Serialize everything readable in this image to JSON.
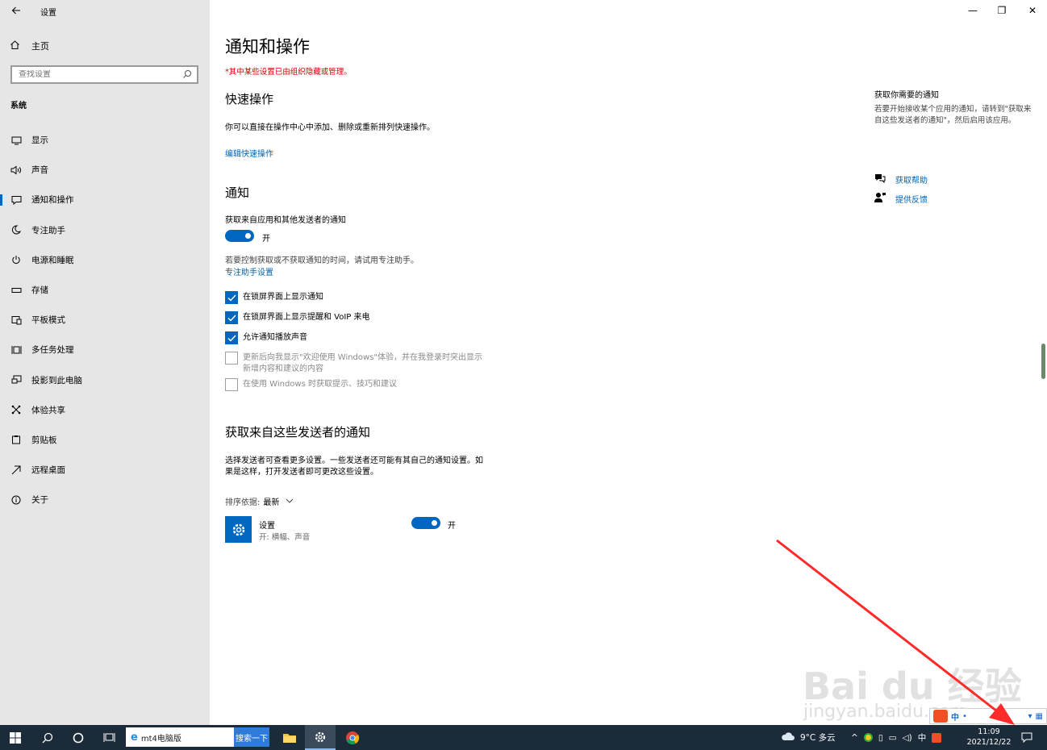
{
  "app": {
    "title": "设置"
  },
  "window": {
    "minimize": "—",
    "restore": "❐",
    "close": "✕"
  },
  "sidebar": {
    "home_label": "主页",
    "search_placeholder": "查找设置",
    "group_title": "系统",
    "items": [
      {
        "label": "显示",
        "icon": "display-icon"
      },
      {
        "label": "声音",
        "icon": "sound-icon"
      },
      {
        "label": "通知和操作",
        "icon": "notification-icon",
        "active": true
      },
      {
        "label": "专注助手",
        "icon": "moon-icon"
      },
      {
        "label": "电源和睡眠",
        "icon": "power-icon"
      },
      {
        "label": "存储",
        "icon": "storage-icon"
      },
      {
        "label": "平板模式",
        "icon": "tablet-icon"
      },
      {
        "label": "多任务处理",
        "icon": "multitask-icon"
      },
      {
        "label": "投影到此电脑",
        "icon": "project-icon"
      },
      {
        "label": "体验共享",
        "icon": "share-icon"
      },
      {
        "label": "剪贴板",
        "icon": "clipboard-icon"
      },
      {
        "label": "远程桌面",
        "icon": "remote-icon"
      },
      {
        "label": "关于",
        "icon": "info-icon"
      }
    ]
  },
  "main": {
    "title": "通知和操作",
    "managed_note": "*其中某些设置已由组织隐藏或管理。",
    "quick": {
      "title": "快速操作",
      "desc": "你可以直接在操作中心中添加、删除或重新排列快速操作。",
      "edit_link": "编辑快速操作"
    },
    "notify": {
      "title": "通知",
      "get_label": "获取来自应用和其他发送者的通知",
      "toggle_label": "开",
      "focus_hint": "若要控制获取或不获取通知的时间，请试用专注助手。",
      "focus_link": "专注助手设置",
      "checks": [
        {
          "label": "在锁屏界面上显示通知",
          "checked": true
        },
        {
          "label": "在锁屏界面上显示提醒和 VoIP 来电",
          "checked": true
        },
        {
          "label": "允许通知播放声音",
          "checked": true
        },
        {
          "label": "更新后向我显示\"欢迎使用 Windows\"体验，并在我登录时突出显示",
          "label2": "新增内容和建议的内容",
          "checked": false
        },
        {
          "label": "在使用 Windows 时获取提示、技巧和建议",
          "checked": false
        }
      ]
    },
    "senders": {
      "title": "获取来自这些发送者的通知",
      "desc1": "选择发送者可查看更多设置。一些发送者还可能有其自己的通知设置。如",
      "desc2": "果是这样，打开发送者即可更改这些设置。",
      "sort_label": "排序依据:",
      "sort_value": "最新",
      "item": {
        "name": "设置",
        "sub": "开: 横幅、声音",
        "toggle_label": "开"
      }
    }
  },
  "right": {
    "title": "获取你需要的通知",
    "text": "若要开始接收某个应用的通知，请转到\"获取来自这些发送者的通知\"，然后启用该应用。",
    "help": "获取帮助",
    "feedback": "提供反馈"
  },
  "overlay": {
    "watermark": "Bai du 经验",
    "watermark_url": "jingyan.baidu.com",
    "arrow_color": "#ff2a2a"
  },
  "taskbar": {
    "search_value": "mt4电脑版",
    "search_button": "搜索一下",
    "weather": "9°C 多云",
    "ime": "中",
    "time": "11:09",
    "date": "2021/12/22"
  }
}
